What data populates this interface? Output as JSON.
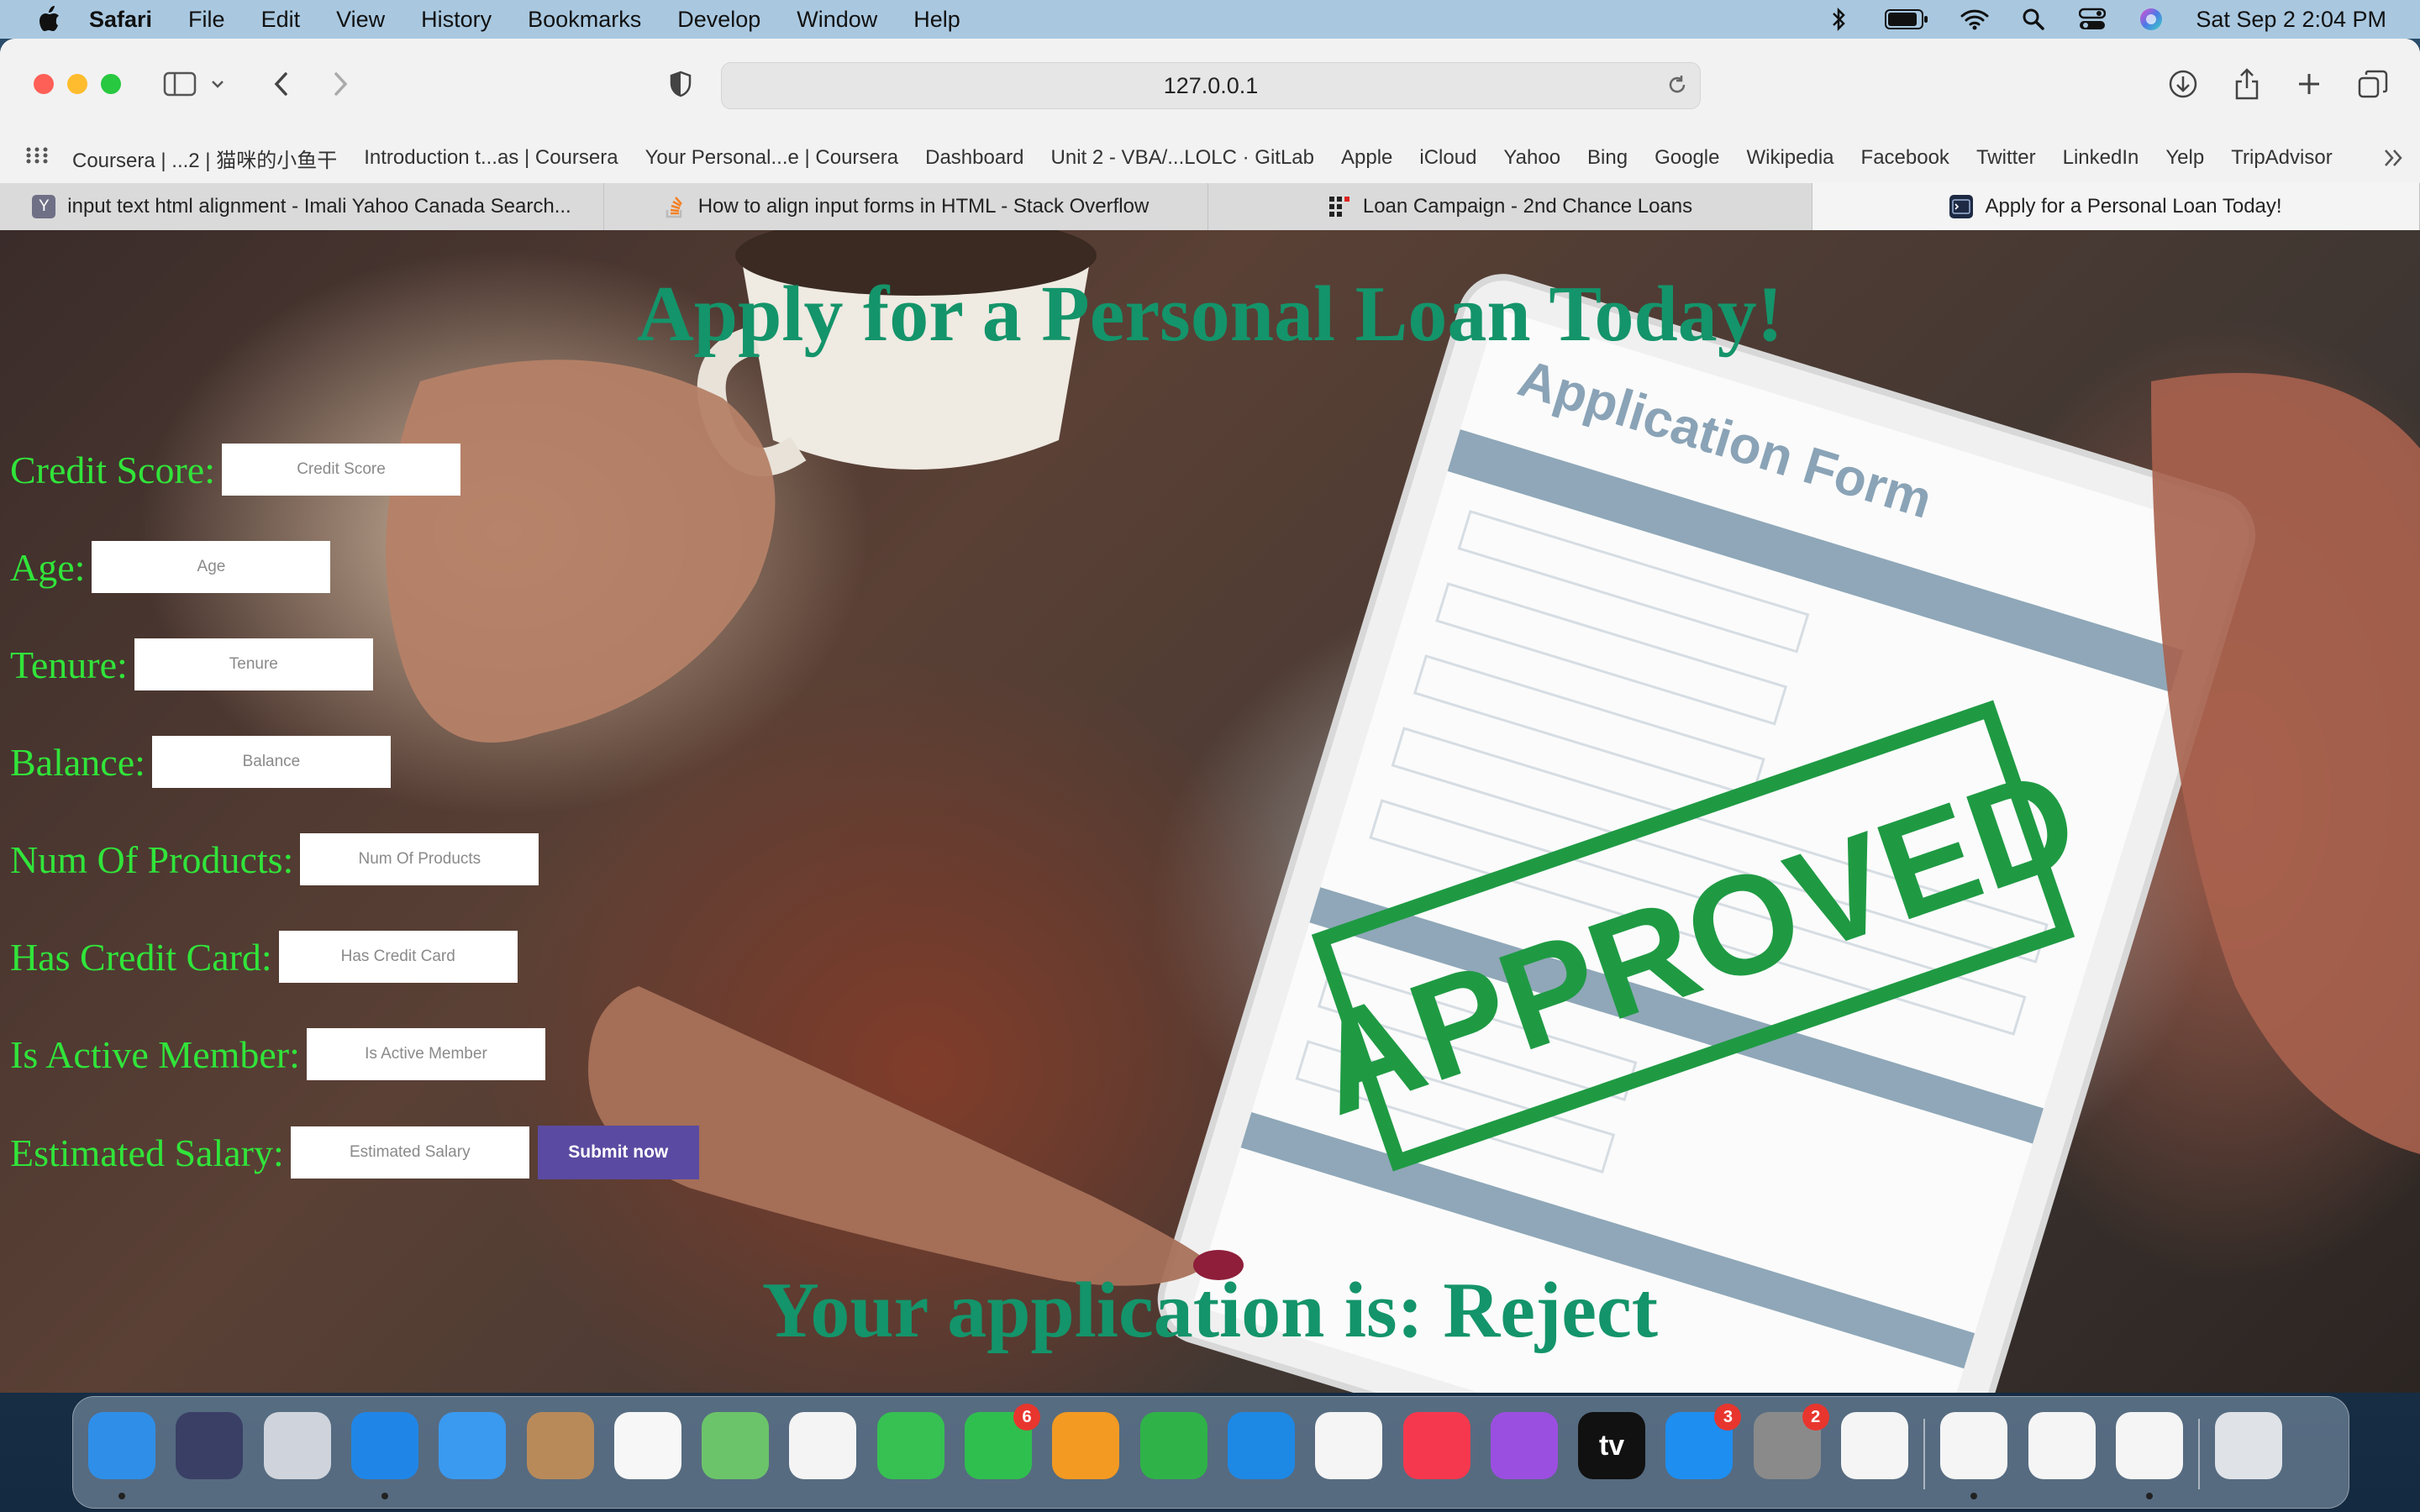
{
  "menubar": {
    "app_name": "Safari",
    "items": [
      "File",
      "Edit",
      "View",
      "History",
      "Bookmarks",
      "Develop",
      "Window",
      "Help"
    ],
    "clock": "Sat Sep 2  2:04 PM"
  },
  "browser": {
    "url": "127.0.0.1",
    "favorites": [
      "Coursera | ...2 | 猫咪的小鱼干",
      "Introduction t...as | Coursera",
      "Your Personal...e | Coursera",
      "Dashboard",
      "Unit 2 - VBA/...LOLC · GitLab",
      "Apple",
      "iCloud",
      "Yahoo",
      "Bing",
      "Google",
      "Wikipedia",
      "Facebook",
      "Twitter",
      "LinkedIn",
      "Yelp",
      "TripAdvisor"
    ],
    "tabs": [
      {
        "label": "input text html alignment - Imali Yahoo Canada Search...",
        "icon": "yahoo-icon",
        "color": "#6f6f86",
        "glyph": "Y"
      },
      {
        "label": "How to align input forms in HTML - Stack Overflow",
        "icon": "stackoverflow-icon",
        "color": "#f48024",
        "glyph": "≡"
      },
      {
        "label": "Loan Campaign - 2nd Chance Loans",
        "icon": "grid-icon",
        "color": "#2a2a2a",
        "glyph": "▦"
      },
      {
        "label": "Apply for a Personal Loan Today!",
        "icon": "terminal-icon",
        "color": "#1e2a44",
        "glyph": "▭"
      }
    ]
  },
  "page": {
    "title": "Apply for a Personal Loan Today!",
    "form": {
      "credit_score": {
        "label": "Credit Score:",
        "placeholder": "Credit Score"
      },
      "age": {
        "label": "Age:",
        "placeholder": "Age"
      },
      "tenure": {
        "label": "Tenure:",
        "placeholder": "Tenure"
      },
      "balance": {
        "label": "Balance:",
        "placeholder": "Balance"
      },
      "num_products": {
        "label": "Num Of Products:",
        "placeholder": "Num Of Products"
      },
      "has_credit_card": {
        "label": "Has Credit Card:",
        "placeholder": "Has Credit Card"
      },
      "is_active_member": {
        "label": "Is Active Member:",
        "placeholder": "Is Active Member"
      },
      "estimated_salary": {
        "label": "Estimated Salary:",
        "placeholder": "Estimated Salary"
      },
      "submit_label": "Submit now"
    },
    "result_text": "Your application is: Reject",
    "background_image": {
      "tablet_heading": "Application Form",
      "stamp_text": "APPROVED"
    },
    "colors": {
      "title": "#14946a",
      "labels": "#31e43a",
      "button": "#5b4aa2"
    }
  },
  "dock": {
    "apps": [
      {
        "name": "finder",
        "color": "#2f8fe8",
        "glyph": ""
      },
      {
        "name": "siri",
        "color": "#3a3f66",
        "glyph": ""
      },
      {
        "name": "launchpad",
        "color": "#cfd4dc",
        "glyph": ""
      },
      {
        "name": "safari",
        "color": "#1f86e8",
        "glyph": ""
      },
      {
        "name": "mail",
        "color": "#3a9af0",
        "glyph": ""
      },
      {
        "name": "contacts",
        "color": "#b88a5a",
        "glyph": ""
      },
      {
        "name": "reminders",
        "color": "#f7f7f7",
        "glyph": ""
      },
      {
        "name": "maps",
        "color": "#6cc46a",
        "glyph": ""
      },
      {
        "name": "photos",
        "color": "#f4f4f4",
        "glyph": ""
      },
      {
        "name": "messages",
        "color": "#36c152",
        "glyph": ""
      },
      {
        "name": "facetime",
        "color": "#2fbf4f",
        "glyph": "",
        "badge": "6"
      },
      {
        "name": "pages",
        "color": "#f39a22",
        "glyph": ""
      },
      {
        "name": "numbers",
        "color": "#2fb348",
        "glyph": ""
      },
      {
        "name": "keynote",
        "color": "#1e88e5",
        "glyph": ""
      },
      {
        "name": "news",
        "color": "#f5f5f5",
        "glyph": ""
      },
      {
        "name": "music",
        "color": "#f6384e",
        "glyph": ""
      },
      {
        "name": "podcasts",
        "color": "#9b4fe0",
        "glyph": ""
      },
      {
        "name": "tv",
        "color": "#111111",
        "glyph": "tv"
      },
      {
        "name": "app-store",
        "color": "#1e8ef0",
        "glyph": "",
        "badge": "3"
      },
      {
        "name": "system-settings",
        "color": "#8a8a8a",
        "glyph": "",
        "badge": "2"
      },
      {
        "name": "freeform",
        "color": "#f5f5f5",
        "glyph": ""
      },
      {
        "name": "vscode",
        "color": "#f5f5f5",
        "glyph": ""
      },
      {
        "name": "word",
        "color": "#f5f5f5",
        "glyph": ""
      },
      {
        "name": "excel",
        "color": "#f5f5f5",
        "glyph": ""
      },
      {
        "name": "trash",
        "color": "#dfe3e8",
        "glyph": ""
      }
    ]
  }
}
